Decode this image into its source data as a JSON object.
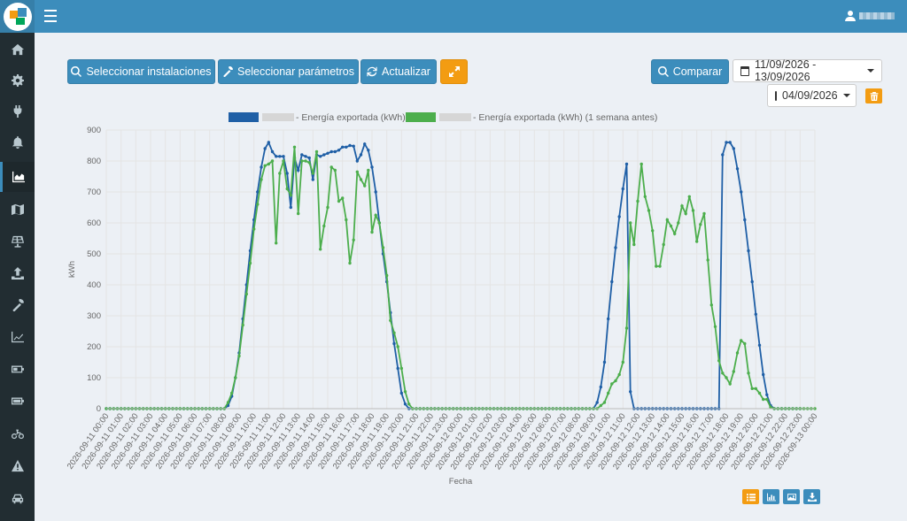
{
  "header": {
    "user_icon": "user-icon",
    "menu_icon": "bars-icon"
  },
  "sidebar": {
    "items": [
      {
        "name": "home",
        "icon": "home-icon"
      },
      {
        "name": "settings",
        "icon": "gear-icon"
      },
      {
        "name": "plug",
        "icon": "plug-icon"
      },
      {
        "name": "alerts",
        "icon": "bell-icon"
      },
      {
        "name": "area-chart",
        "icon": "area-chart-icon",
        "active": true
      },
      {
        "name": "map",
        "icon": "map-icon"
      },
      {
        "name": "solar",
        "icon": "solar-panel-icon"
      },
      {
        "name": "upload",
        "icon": "upload-icon"
      },
      {
        "name": "tools",
        "icon": "wrench-icon"
      },
      {
        "name": "line-chart",
        "icon": "line-chart-icon"
      },
      {
        "name": "battery",
        "icon": "battery-icon"
      },
      {
        "name": "battery-full",
        "icon": "battery-full-icon"
      },
      {
        "name": "bicycle",
        "icon": "bicycle-icon"
      },
      {
        "name": "warning",
        "icon": "warning-icon"
      },
      {
        "name": "car",
        "icon": "car-icon"
      }
    ]
  },
  "toolbar": {
    "select_installations": "Seleccionar instalaciones",
    "select_parameters": "Seleccionar parámetros",
    "refresh": "Actualizar",
    "compare": "Comparar",
    "date_range": "11/09/2026 - 13/09/2026",
    "compare_date": "04/09/2026"
  },
  "chart_data": {
    "type": "line",
    "ylabel": "kWh",
    "xlabel": "Fecha",
    "ylim": [
      0,
      900
    ],
    "yticks": [
      0,
      100,
      200,
      300,
      400,
      500,
      600,
      700,
      800,
      900
    ],
    "x_start": "2026-09-11 00:00",
    "x_end": "2026-09-13 00:00",
    "xticks": [
      "2026-09-11 00:00",
      "2026-09-11 01:00",
      "2026-09-11 02:00",
      "2026-09-11 03:00",
      "2026-09-11 04:00",
      "2026-09-11 05:00",
      "2026-09-11 06:00",
      "2026-09-11 07:00",
      "2026-09-11 08:00",
      "2026-09-11 09:00",
      "2026-09-11 10:00",
      "2026-09-11 11:00",
      "2026-09-11 12:00",
      "2026-09-11 13:00",
      "2026-09-11 14:00",
      "2026-09-11 15:00",
      "2026-09-11 16:00",
      "2026-09-11 17:00",
      "2026-09-11 18:00",
      "2026-09-11 19:00",
      "2026-09-11 20:00",
      "2026-09-11 21:00",
      "2026-09-11 22:00",
      "2026-09-11 23:00",
      "2026-09-12 00:00",
      "2026-09-12 01:00",
      "2026-09-12 02:00",
      "2026-09-12 03:00",
      "2026-09-12 04:00",
      "2026-09-12 05:00",
      "2026-09-12 06:00",
      "2026-09-12 07:00",
      "2026-09-12 08:00",
      "2026-09-12 09:00",
      "2026-09-12 10:00",
      "2026-09-12 11:00",
      "2026-09-12 12:00",
      "2026-09-12 13:00",
      "2026-09-12 14:00",
      "2026-09-12 15:00",
      "2026-09-12 16:00",
      "2026-09-12 17:00",
      "2026-09-12 18:00",
      "2026-09-12 19:00",
      "2026-09-12 20:00",
      "2026-09-12 21:00",
      "2026-09-12 22:00",
      "2026-09-12 23:00",
      "2026-09-13 00:00"
    ],
    "grid": true,
    "legend_position": "top",
    "series": [
      {
        "name": "- Energía exportada (kWh)",
        "color": "#1f5fa6",
        "points": [
          [
            "2026-09-11 00:00",
            0
          ],
          [
            "2026-09-11 08:00",
            0
          ],
          [
            "2026-09-11 08:15",
            10
          ],
          [
            "2026-09-11 08:30",
            40
          ],
          [
            "2026-09-11 08:45",
            100
          ],
          [
            "2026-09-11 09:00",
            180
          ],
          [
            "2026-09-11 09:15",
            290
          ],
          [
            "2026-09-11 09:30",
            400
          ],
          [
            "2026-09-11 09:45",
            510
          ],
          [
            "2026-09-11 10:00",
            610
          ],
          [
            "2026-09-11 10:15",
            700
          ],
          [
            "2026-09-11 10:30",
            780
          ],
          [
            "2026-09-11 10:45",
            840
          ],
          [
            "2026-09-11 11:00",
            860
          ],
          [
            "2026-09-11 11:15",
            830
          ],
          [
            "2026-09-11 11:30",
            815
          ],
          [
            "2026-09-11 11:45",
            815
          ],
          [
            "2026-09-11 12:00",
            815
          ],
          [
            "2026-09-11 12:15",
            760
          ],
          [
            "2026-09-11 12:30",
            650
          ],
          [
            "2026-09-11 12:45",
            810
          ],
          [
            "2026-09-11 13:00",
            770
          ],
          [
            "2026-09-11 13:15",
            820
          ],
          [
            "2026-09-11 13:30",
            815
          ],
          [
            "2026-09-11 13:45",
            810
          ],
          [
            "2026-09-11 14:00",
            740
          ],
          [
            "2026-09-11 14:15",
            820
          ],
          [
            "2026-09-11 14:30",
            815
          ],
          [
            "2026-09-11 14:45",
            820
          ],
          [
            "2026-09-11 15:00",
            825
          ],
          [
            "2026-09-11 15:15",
            830
          ],
          [
            "2026-09-11 15:30",
            830
          ],
          [
            "2026-09-11 15:45",
            835
          ],
          [
            "2026-09-11 16:00",
            845
          ],
          [
            "2026-09-11 16:15",
            845
          ],
          [
            "2026-09-11 16:30",
            850
          ],
          [
            "2026-09-11 16:45",
            848
          ],
          [
            "2026-09-11 17:00",
            800
          ],
          [
            "2026-09-11 17:15",
            820
          ],
          [
            "2026-09-11 17:30",
            855
          ],
          [
            "2026-09-11 17:45",
            835
          ],
          [
            "2026-09-11 18:00",
            780
          ],
          [
            "2026-09-11 18:15",
            700
          ],
          [
            "2026-09-11 18:30",
            600
          ],
          [
            "2026-09-11 18:45",
            500
          ],
          [
            "2026-09-11 19:00",
            410
          ],
          [
            "2026-09-11 19:15",
            310
          ],
          [
            "2026-09-11 19:30",
            210
          ],
          [
            "2026-09-11 19:45",
            130
          ],
          [
            "2026-09-11 20:00",
            50
          ],
          [
            "2026-09-11 20:15",
            15
          ],
          [
            "2026-09-11 20:30",
            0
          ],
          [
            "2026-09-12 09:00",
            0
          ],
          [
            "2026-09-12 09:15",
            20
          ],
          [
            "2026-09-12 09:30",
            70
          ],
          [
            "2026-09-12 09:45",
            150
          ],
          [
            "2026-09-12 10:00",
            290
          ],
          [
            "2026-09-12 10:15",
            410
          ],
          [
            "2026-09-12 10:30",
            520
          ],
          [
            "2026-09-12 10:45",
            620
          ],
          [
            "2026-09-12 11:00",
            710
          ],
          [
            "2026-09-12 11:15",
            790
          ],
          [
            "2026-09-12 11:30",
            55
          ],
          [
            "2026-09-12 11:45",
            0
          ],
          [
            "2026-09-12 17:30",
            0
          ],
          [
            "2026-09-12 17:45",
            820
          ],
          [
            "2026-09-12 18:00",
            860
          ],
          [
            "2026-09-12 18:15",
            860
          ],
          [
            "2026-09-12 18:30",
            840
          ],
          [
            "2026-09-12 18:45",
            775
          ],
          [
            "2026-09-12 19:00",
            700
          ],
          [
            "2026-09-12 19:15",
            610
          ],
          [
            "2026-09-12 19:30",
            510
          ],
          [
            "2026-09-12 19:45",
            410
          ],
          [
            "2026-09-12 20:00",
            305
          ],
          [
            "2026-09-12 20:15",
            205
          ],
          [
            "2026-09-12 20:30",
            110
          ],
          [
            "2026-09-12 20:45",
            45
          ],
          [
            "2026-09-12 21:00",
            10
          ],
          [
            "2026-09-12 21:15",
            0
          ],
          [
            "2026-09-12 23:00",
            0
          ]
        ]
      },
      {
        "name": "- Energía exportada (kWh) (1 semana antes)",
        "color": "#4cae4c",
        "points": [
          [
            "2026-09-11 00:00",
            0
          ],
          [
            "2026-09-11 08:00",
            0
          ],
          [
            "2026-09-11 08:15",
            20
          ],
          [
            "2026-09-11 08:30",
            50
          ],
          [
            "2026-09-11 08:45",
            100
          ],
          [
            "2026-09-11 09:00",
            170
          ],
          [
            "2026-09-11 09:15",
            270
          ],
          [
            "2026-09-11 09:30",
            370
          ],
          [
            "2026-09-11 09:45",
            470
          ],
          [
            "2026-09-11 10:00",
            580
          ],
          [
            "2026-09-11 10:15",
            660
          ],
          [
            "2026-09-11 10:30",
            740
          ],
          [
            "2026-09-11 10:45",
            785
          ],
          [
            "2026-09-11 11:00",
            790
          ],
          [
            "2026-09-11 11:15",
            800
          ],
          [
            "2026-09-11 11:30",
            535
          ],
          [
            "2026-09-11 11:45",
            760
          ],
          [
            "2026-09-11 12:00",
            800
          ],
          [
            "2026-09-11 12:15",
            710
          ],
          [
            "2026-09-11 12:30",
            690
          ],
          [
            "2026-09-11 12:45",
            845
          ],
          [
            "2026-09-11 13:00",
            630
          ],
          [
            "2026-09-11 13:15",
            800
          ],
          [
            "2026-09-11 13:30",
            800
          ],
          [
            "2026-09-11 13:45",
            795
          ],
          [
            "2026-09-11 14:00",
            760
          ],
          [
            "2026-09-11 14:15",
            830
          ],
          [
            "2026-09-11 14:30",
            515
          ],
          [
            "2026-09-11 14:45",
            590
          ],
          [
            "2026-09-11 15:00",
            650
          ],
          [
            "2026-09-11 15:15",
            780
          ],
          [
            "2026-09-11 15:30",
            770
          ],
          [
            "2026-09-11 15:45",
            670
          ],
          [
            "2026-09-11 16:00",
            680
          ],
          [
            "2026-09-11 16:15",
            610
          ],
          [
            "2026-09-11 16:30",
            470
          ],
          [
            "2026-09-11 16:45",
            545
          ],
          [
            "2026-09-11 17:00",
            765
          ],
          [
            "2026-09-11 17:15",
            740
          ],
          [
            "2026-09-11 17:30",
            720
          ],
          [
            "2026-09-11 17:45",
            770
          ],
          [
            "2026-09-11 18:00",
            570
          ],
          [
            "2026-09-11 18:15",
            625
          ],
          [
            "2026-09-11 18:30",
            600
          ],
          [
            "2026-09-11 18:45",
            520
          ],
          [
            "2026-09-11 19:00",
            430
          ],
          [
            "2026-09-11 19:15",
            285
          ],
          [
            "2026-09-11 19:30",
            245
          ],
          [
            "2026-09-11 19:45",
            200
          ],
          [
            "2026-09-11 20:00",
            130
          ],
          [
            "2026-09-11 20:15",
            55
          ],
          [
            "2026-09-11 20:30",
            15
          ],
          [
            "2026-09-11 20:45",
            0
          ],
          [
            "2026-09-12 09:15",
            0
          ],
          [
            "2026-09-12 09:30",
            10
          ],
          [
            "2026-09-12 09:45",
            20
          ],
          [
            "2026-09-12 10:00",
            50
          ],
          [
            "2026-09-12 10:15",
            80
          ],
          [
            "2026-09-12 10:30",
            90
          ],
          [
            "2026-09-12 10:45",
            110
          ],
          [
            "2026-09-12 11:00",
            150
          ],
          [
            "2026-09-12 11:15",
            260
          ],
          [
            "2026-09-12 11:30",
            600
          ],
          [
            "2026-09-12 11:45",
            530
          ],
          [
            "2026-09-12 12:00",
            670
          ],
          [
            "2026-09-12 12:15",
            790
          ],
          [
            "2026-09-12 12:30",
            685
          ],
          [
            "2026-09-12 12:45",
            640
          ],
          [
            "2026-09-12 13:00",
            575
          ],
          [
            "2026-09-12 13:15",
            460
          ],
          [
            "2026-09-12 13:30",
            460
          ],
          [
            "2026-09-12 13:45",
            530
          ],
          [
            "2026-09-12 14:00",
            610
          ],
          [
            "2026-09-12 14:15",
            590
          ],
          [
            "2026-09-12 14:30",
            565
          ],
          [
            "2026-09-12 14:45",
            600
          ],
          [
            "2026-09-12 15:00",
            655
          ],
          [
            "2026-09-12 15:15",
            630
          ],
          [
            "2026-09-12 15:30",
            685
          ],
          [
            "2026-09-12 15:45",
            640
          ],
          [
            "2026-09-12 16:00",
            540
          ],
          [
            "2026-09-12 16:15",
            595
          ],
          [
            "2026-09-12 16:30",
            630
          ],
          [
            "2026-09-12 16:45",
            480
          ],
          [
            "2026-09-12 17:00",
            335
          ],
          [
            "2026-09-12 17:15",
            265
          ],
          [
            "2026-09-12 17:30",
            155
          ],
          [
            "2026-09-12 17:45",
            115
          ],
          [
            "2026-09-12 18:00",
            100
          ],
          [
            "2026-09-12 18:15",
            80
          ],
          [
            "2026-09-12 18:30",
            120
          ],
          [
            "2026-09-12 18:45",
            180
          ],
          [
            "2026-09-12 19:00",
            220
          ],
          [
            "2026-09-12 19:15",
            210
          ],
          [
            "2026-09-12 19:30",
            115
          ],
          [
            "2026-09-12 19:45",
            65
          ],
          [
            "2026-09-12 20:00",
            65
          ],
          [
            "2026-09-12 20:15",
            50
          ],
          [
            "2026-09-12 20:30",
            30
          ],
          [
            "2026-09-12 20:45",
            30
          ],
          [
            "2026-09-12 21:00",
            5
          ],
          [
            "2026-09-12 21:15",
            0
          ],
          [
            "2026-09-13 00:00",
            0
          ]
        ]
      }
    ]
  },
  "bottom_buttons": [
    {
      "name": "list",
      "icon": "list-icon",
      "color": "#f39c12"
    },
    {
      "name": "bar-chart",
      "icon": "bar-chart-icon",
      "color": "#3c8dbc"
    },
    {
      "name": "image",
      "icon": "image-icon",
      "color": "#3c8dbc"
    },
    {
      "name": "download",
      "icon": "download-icon",
      "color": "#3c8dbc"
    }
  ]
}
